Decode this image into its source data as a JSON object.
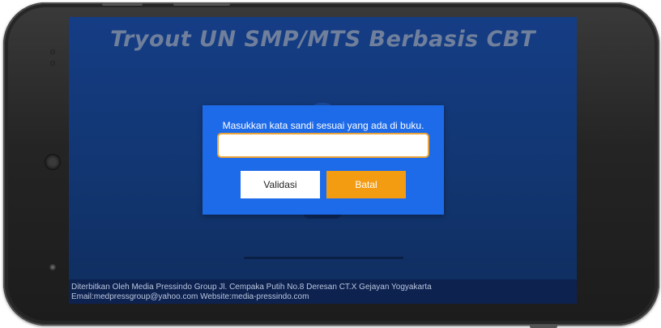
{
  "app": {
    "title": "Tryout UN SMP/MTS Berbasis CBT"
  },
  "dialog": {
    "message": "Masukkan kata sandi sesuai yang ada di buku.",
    "password_value": "",
    "validate_label": "Validasi",
    "cancel_label": "Batal"
  },
  "footer": {
    "line1": "Diterbitkan Oleh Media Pressindo Group Jl. Cempaka Putih No.8 Deresan CT.X Gejayan Yogyakarta",
    "line2": "Email:medpressgroup@yahoo.com Website:media-pressindo.com"
  },
  "colors": {
    "screen_background": "#153d85",
    "dialog_background": "#1e6bea",
    "validate_button": "#ffffff",
    "cancel_button": "#f39c12",
    "input_border": "#e9a238",
    "title_text": "#6f7f9c"
  }
}
